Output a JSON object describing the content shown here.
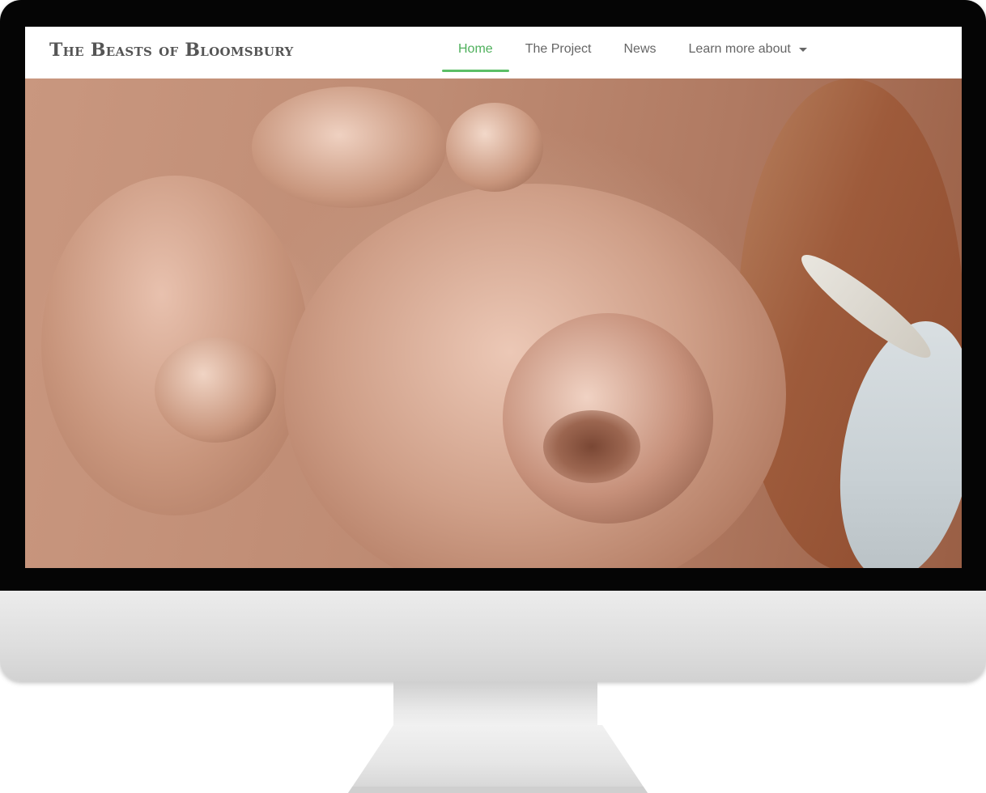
{
  "site": {
    "title": "The Beasts of Bloomsbury"
  },
  "nav": {
    "items": [
      {
        "label": "Home",
        "active": true
      },
      {
        "label": "The Project",
        "active": false
      },
      {
        "label": "News",
        "active": false
      },
      {
        "label": "Learn more about",
        "active": false,
        "has_dropdown": true
      }
    ]
  },
  "hero": {
    "image": "clay-lion-head-sculpture"
  },
  "colors": {
    "accent": "#5bbf66",
    "nav_text": "#666666",
    "title_text": "#555555"
  }
}
